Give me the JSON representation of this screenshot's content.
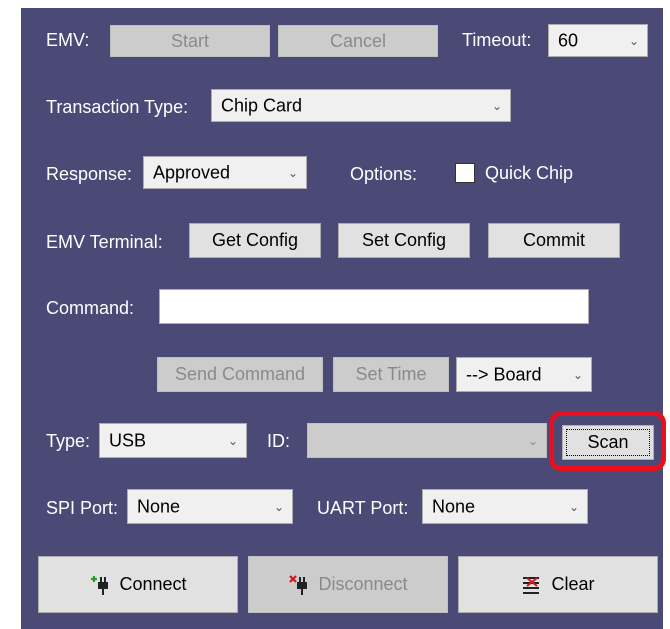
{
  "emv": {
    "label": "EMV:",
    "start_label": "Start",
    "cancel_label": "Cancel",
    "timeout_label": "Timeout:",
    "timeout_value": "60"
  },
  "transaction": {
    "label": "Transaction Type:",
    "value": "Chip Card"
  },
  "response": {
    "label": "Response:",
    "value": "Approved"
  },
  "options": {
    "label": "Options:",
    "quick_chip_label": "Quick Chip",
    "quick_chip_checked": false
  },
  "terminal": {
    "label": "EMV Terminal:",
    "get_config_label": "Get Config",
    "set_config_label": "Set Config",
    "commit_label": "Commit"
  },
  "command": {
    "label": "Command:",
    "value": "",
    "send_label": "Send Command",
    "set_time_label": "Set Time",
    "target_value": "--> Board"
  },
  "connection": {
    "type_label": "Type:",
    "type_value": "USB",
    "id_label": "ID:",
    "id_value": "",
    "scan_label": "Scan"
  },
  "ports": {
    "spi_label": "SPI Port:",
    "spi_value": "None",
    "uart_label": "UART Port:",
    "uart_value": "None"
  },
  "actions": {
    "connect_label": "Connect",
    "disconnect_label": "Disconnect",
    "clear_label": "Clear"
  },
  "colors": {
    "panel": "#4b4a77",
    "highlight": "#e8101f",
    "connect_icon": "#2e9b2e",
    "disconnect_icon": "#d11a1a"
  }
}
